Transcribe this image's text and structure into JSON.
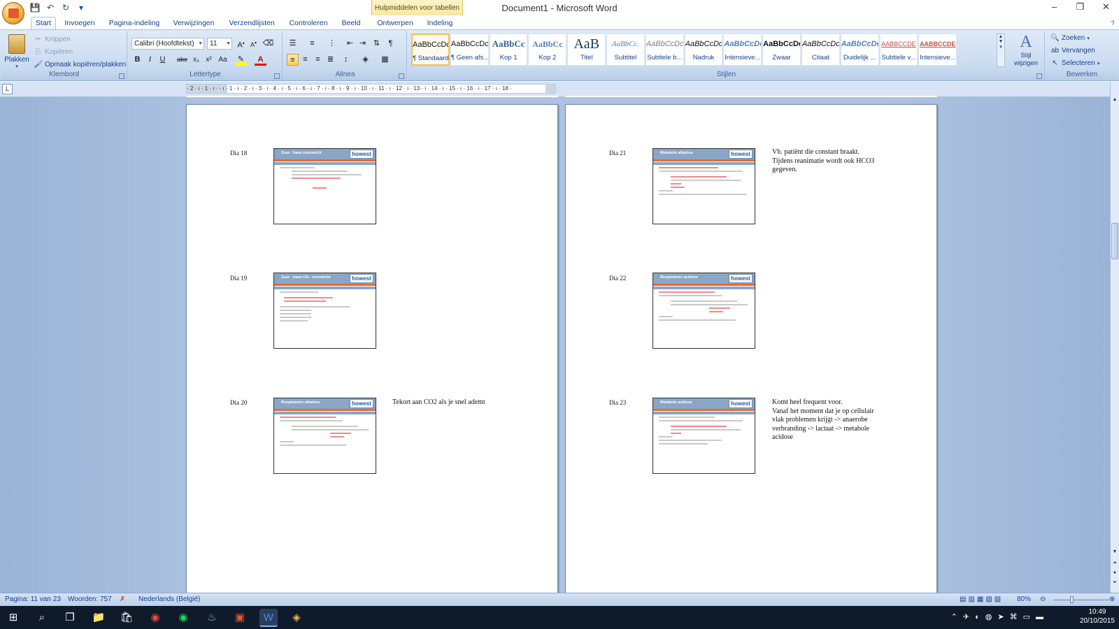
{
  "window": {
    "title": "Document1 - Microsoft Word",
    "context_tab_header": "Hulpmiddelen voor tabellen",
    "controls": [
      "–",
      "❐",
      "✕"
    ]
  },
  "tabs": [
    "Start",
    "Invoegen",
    "Pagina-indeling",
    "Verwijzingen",
    "Verzendlijsten",
    "Controleren",
    "Beeld",
    "Ontwerpen",
    "Indeling"
  ],
  "ribbon": {
    "clipboard": {
      "label": "Klembord",
      "paste": "Plakken",
      "cut": "Knippen",
      "copy": "Kopiëren",
      "format_painter": "Opmaak kopiëren/plakken"
    },
    "font": {
      "label": "Lettertype",
      "font_name": "Calibri (Hoofdtekst)",
      "font_size": "11"
    },
    "paragraph": {
      "label": "Alinea"
    },
    "styles": {
      "label": "Stijlen",
      "items": [
        {
          "preview": "AaBbCcDc",
          "name": "¶ Standaard"
        },
        {
          "preview": "AaBbCcDc",
          "name": "¶ Geen afs..."
        },
        {
          "preview": "AaBbCc",
          "name": "Kop 1"
        },
        {
          "preview": "AaBbCc",
          "name": "Kop 2"
        },
        {
          "preview": "AaB",
          "name": "Titel"
        },
        {
          "preview": "AaBbCc.",
          "name": "Subtitel"
        },
        {
          "preview": "AaBbCcDc",
          "name": "Subtiele b..."
        },
        {
          "preview": "AaBbCcDc",
          "name": "Nadruk"
        },
        {
          "preview": "AaBbCcDc",
          "name": "Intensieve..."
        },
        {
          "preview": "AaBbCcDc",
          "name": "Zwaar"
        },
        {
          "preview": "AaBbCcDc",
          "name": "Citaat"
        },
        {
          "preview": "AaBbCcDc",
          "name": "Duidelijk ..."
        },
        {
          "preview": "AABBCCDE",
          "name": "Subtiele v..."
        },
        {
          "preview": "AABBCCDE",
          "name": "Intensieve..."
        }
      ],
      "change_styles": "Stijl wijzigen"
    },
    "editing": {
      "label": "Bewerken",
      "find": "Zoeken",
      "replace": "Vervangen",
      "select": "Selecteren"
    }
  },
  "ruler": {
    "text": "· 2 · ı · 1 · ı ·   · ı · 1 · ı · 2 · ı · 3 · ı · 4 · ı · 5 · ı · 6 · ı · 7 · ı · 8 · ı · 9 · ı · 10 · ı · 11 · ı · 12 · ı · 13 · ı · 14 · ı · 15 · ı · 16 · ı · 17 · ı · 18 ·"
  },
  "pages": [
    {
      "slides": [
        {
          "label": "Dia 18",
          "slide_title": "Zuur - base evenwicht",
          "note": ""
        },
        {
          "label": "Dia 19",
          "slide_title": "Zuur - base CN - evenwicht",
          "note": ""
        },
        {
          "label": "Dia 20",
          "slide_title": "Respiratoire alkalose",
          "note": "Tekort aan CO2 als je snel ademt"
        }
      ]
    },
    {
      "slides": [
        {
          "label": "Dia 21",
          "slide_title": "Metabole alkalose",
          "note": "Vb. patiënt die constant braakt.\nTijdens reanimatie wordt ook HCO3 gegeven."
        },
        {
          "label": "Dia 22",
          "slide_title": "Respiratoire acidose",
          "note": ""
        },
        {
          "label": "Dia 23",
          "slide_title": "Metabole acidose",
          "note": "Komt heel frequent voor.\nVanaf het moment dat je op cellulair vlak problemen krijgt -> anaerobe verbranding -> lactaat -> metabole acidose"
        }
      ]
    }
  ],
  "slide_logo": "howest",
  "status": {
    "page": "Pagina: 11 van 23",
    "words": "Woorden: 757",
    "language": "Nederlands (België)",
    "zoom": "80%"
  },
  "taskbar": {
    "time": "10:49",
    "date": "20/10/2015"
  },
  "colors": {
    "ribbon": "#c9daf0",
    "accent_orange": "#e66b2e",
    "slide_header": "#8aa6c6"
  }
}
